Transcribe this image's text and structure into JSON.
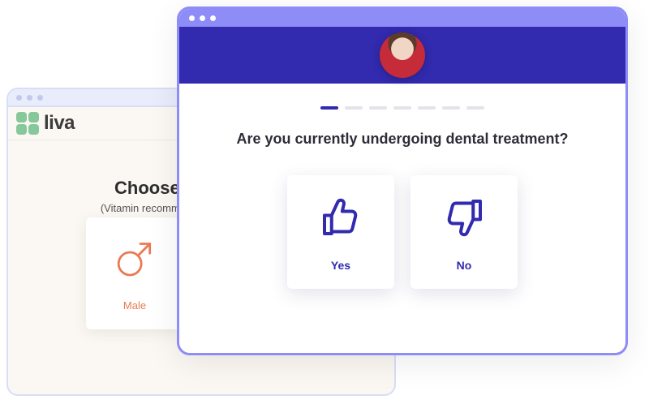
{
  "back_window": {
    "brand": "liva",
    "heading": "Choose your gender",
    "subheading": "(Vitamin recommendations vary by gender)",
    "gender_male_label": "Male"
  },
  "front_window": {
    "question": "Are you currently undergoing dental treatment?",
    "option_yes": "Yes",
    "option_no": "No",
    "progress": {
      "current": 1,
      "total": 7
    }
  }
}
